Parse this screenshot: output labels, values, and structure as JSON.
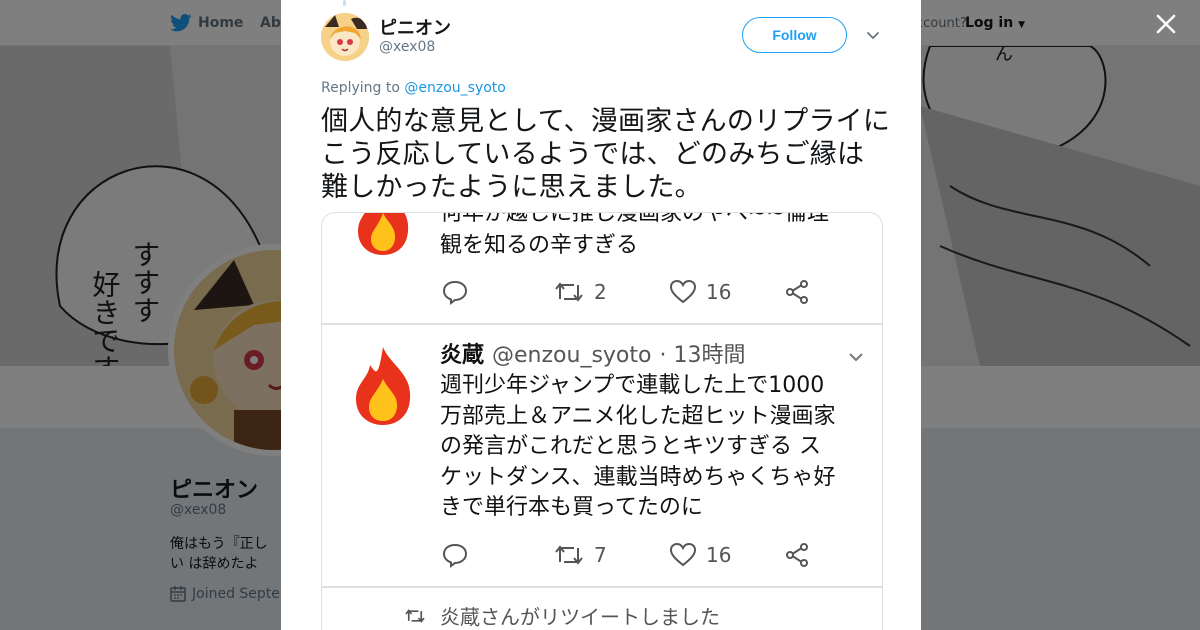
{
  "background": {
    "nav": {
      "home_label": "Home",
      "about_label": "Abo",
      "account_prompt": "ccount?",
      "login_label": "Log in"
    },
    "profile": {
      "name": "ピニオン",
      "handle": "@xex08",
      "bio": "俺はもう『正しい は辞めたよ",
      "joined": "Joined Septen"
    },
    "banner_text": {
      "lines": [
        "好すす",
        "きすす",
        "です"
      ]
    }
  },
  "modal": {
    "author": {
      "name": "ピニオン",
      "handle": "@xex08"
    },
    "follow_label": "Follow",
    "replying_prefix": "Replying to",
    "replying_to": "@enzou_syoto",
    "tweet_text": "個人的な意見として、漫画家さんのリプライにこう反応しているようでは、どのみちご縁は難しかったように思えました。",
    "media": {
      "top_partial_line_1": "何年か越しに推し漫画家のやべ~~倫理",
      "top_partial_line_2": "観を知るの辛すぎる",
      "actions_1": {
        "retweets": "2",
        "likes": "16"
      },
      "quoted_author": "炎蔵",
      "quoted_handle": "@enzou_syoto",
      "quoted_time": "· 13時間",
      "quoted_lines": [
        "週刊少年ジャンプで連載した上で1000",
        "万部売上＆アニメ化した超ヒット漫画家",
        "の発言がこれだと思うとキツすぎる ス",
        "ケットダンス、連載当時めちゃくちゃ好",
        "きで単行本も買ってたのに"
      ],
      "actions_2": {
        "retweets": "7",
        "likes": "16"
      },
      "retweet_note": "炎蔵さんがリツイートしました"
    }
  },
  "colors": {
    "accent": "#1da1f2",
    "link": "#1b95e0",
    "fire": "#e8321c",
    "fire_inner": "#ffc21a"
  }
}
